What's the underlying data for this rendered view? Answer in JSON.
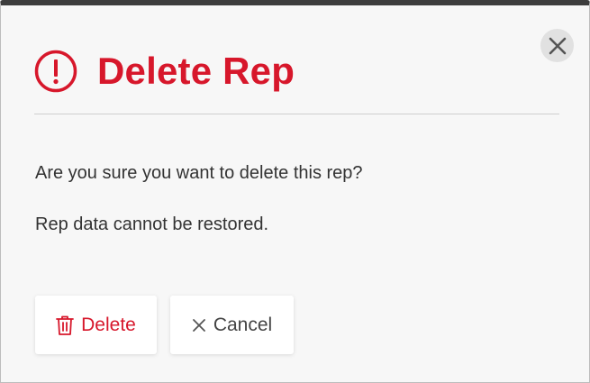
{
  "dialog": {
    "title": "Delete Rep",
    "message_line1": "Are you sure you want to delete this rep?",
    "message_line2": "Rep data cannot be restored.",
    "icons": {
      "header": "alert-circle-icon",
      "close": "close-icon",
      "delete": "trash-icon",
      "cancel": "x-icon"
    },
    "colors": {
      "accent": "#d7172b",
      "text": "#333333",
      "top_bar": "#3d3d3d",
      "background": "#f7f7f7"
    }
  },
  "buttons": {
    "delete_label": "Delete",
    "cancel_label": "Cancel"
  }
}
